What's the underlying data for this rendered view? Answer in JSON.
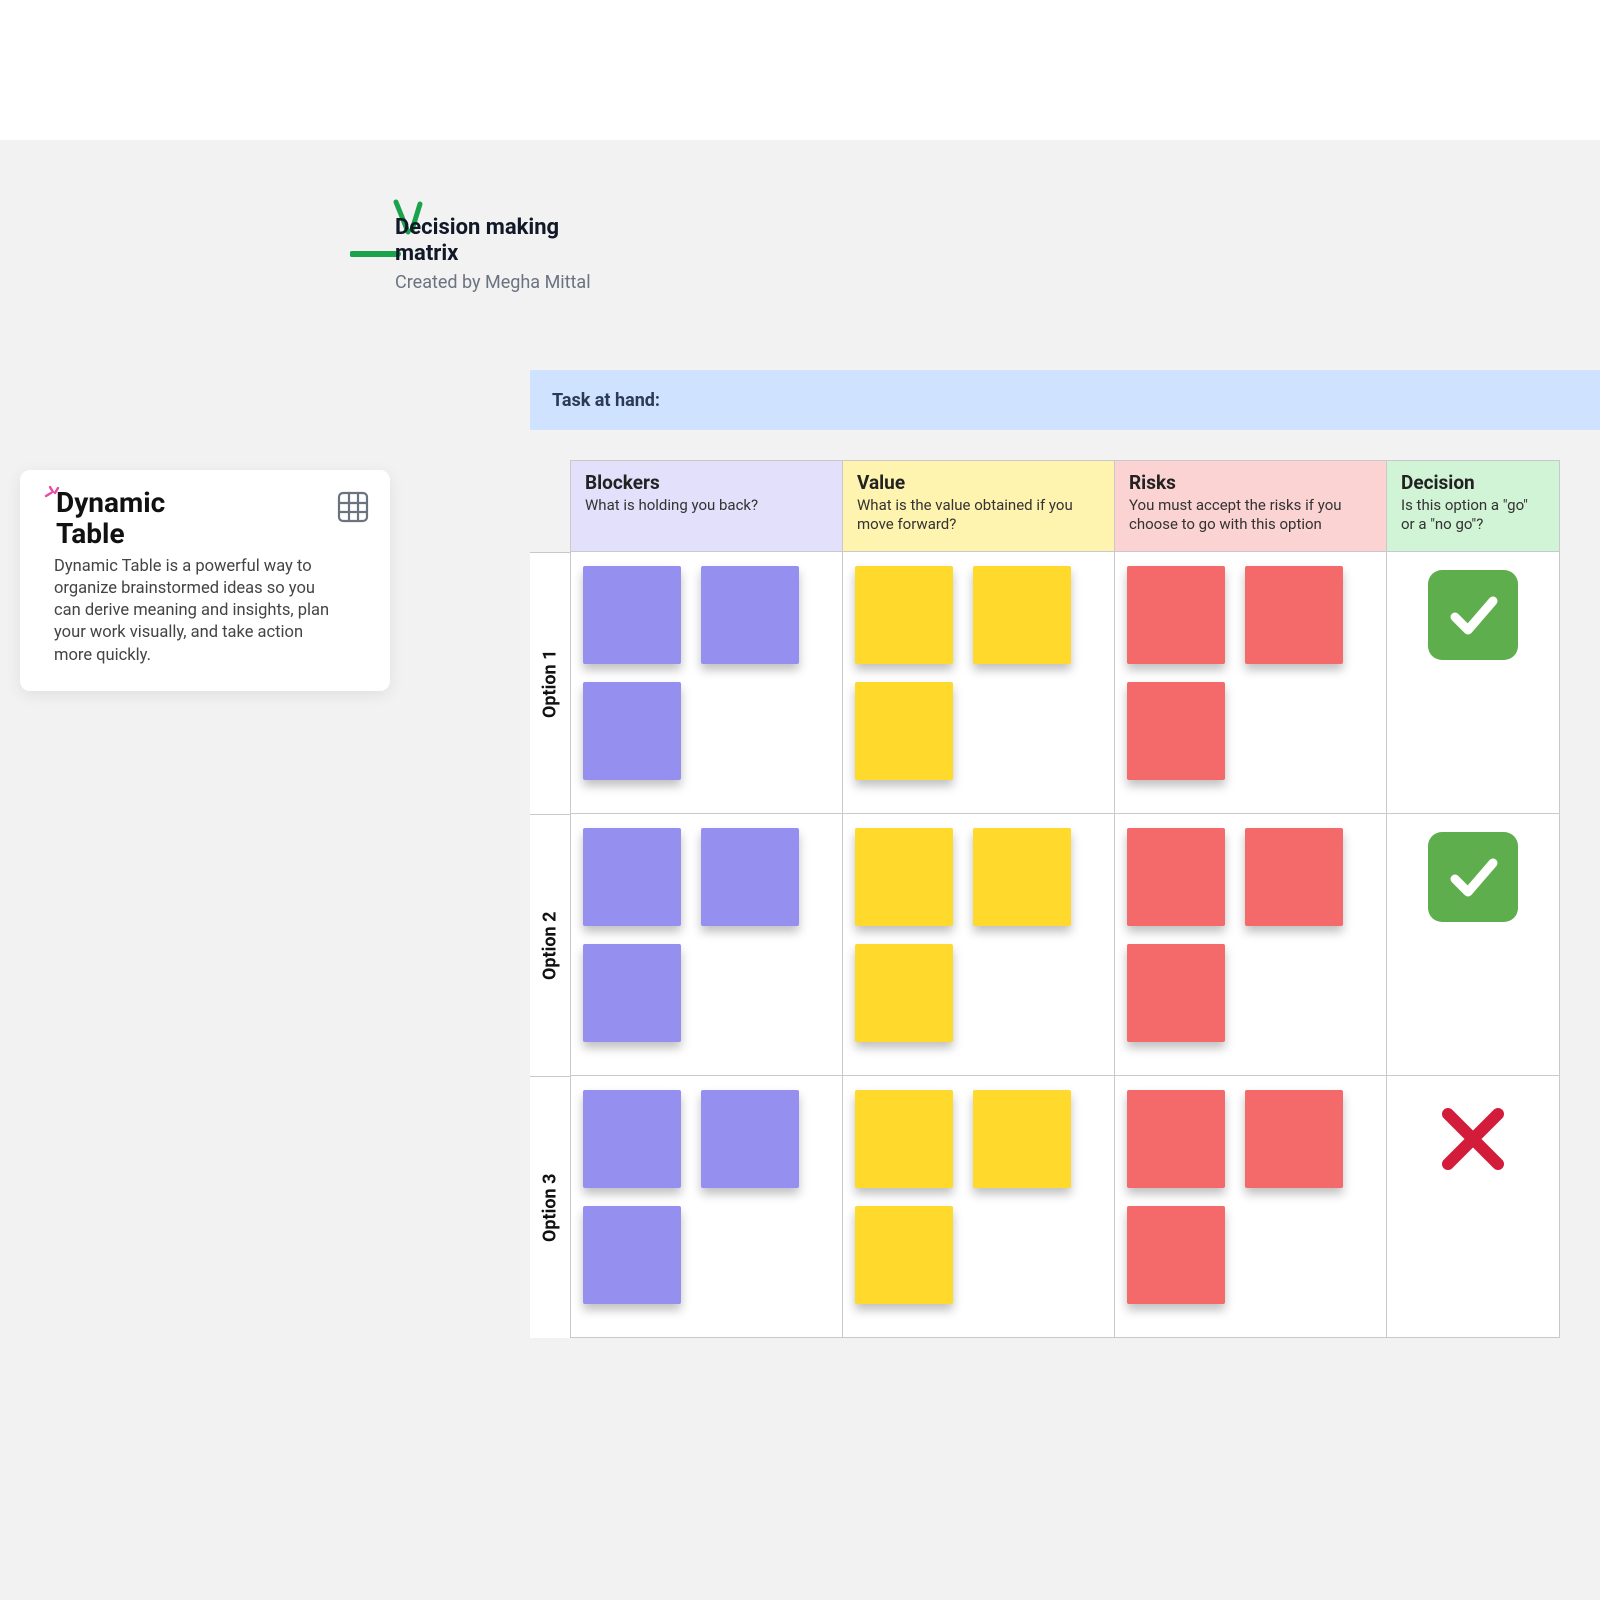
{
  "header": {
    "title": "Decision making matrix",
    "byline": "Created by Megha Mittal"
  },
  "task_banner": {
    "label": "Task at hand:"
  },
  "info_card": {
    "title": "Dynamic Table",
    "description": "Dynamic Table is a powerful way to organize brainstormed ideas so you can derive meaning and insights, plan your work visually, and take action more quickly."
  },
  "columns": {
    "blockers": {
      "title": "Blockers",
      "subtitle": "What is holding you back?"
    },
    "value": {
      "title": "Value",
      "subtitle": "What is the value obtained if you move forward?"
    },
    "risks": {
      "title": "Risks",
      "subtitle": "You must accept the risks if you choose to go with this option"
    },
    "decision": {
      "title": "Decision",
      "subtitle": "Is this option a \"go\" or a \"no go\"?"
    }
  },
  "rows": [
    {
      "label": "Option 1",
      "blockers": 3,
      "value": 3,
      "risks": 3,
      "decision": "go"
    },
    {
      "label": "Option 2",
      "blockers": 3,
      "value": 3,
      "risks": 3,
      "decision": "go"
    },
    {
      "label": "Option 3",
      "blockers": 3,
      "value": 3,
      "risks": 3,
      "decision": "nogo"
    }
  ],
  "colors": {
    "sticky_purple": "#9590f0",
    "sticky_yellow": "#ffd92c",
    "sticky_red": "#f46a6a",
    "go_badge": "#5fae4d",
    "nogo_x": "#d31b3a",
    "accent_green": "#1aa34a"
  }
}
